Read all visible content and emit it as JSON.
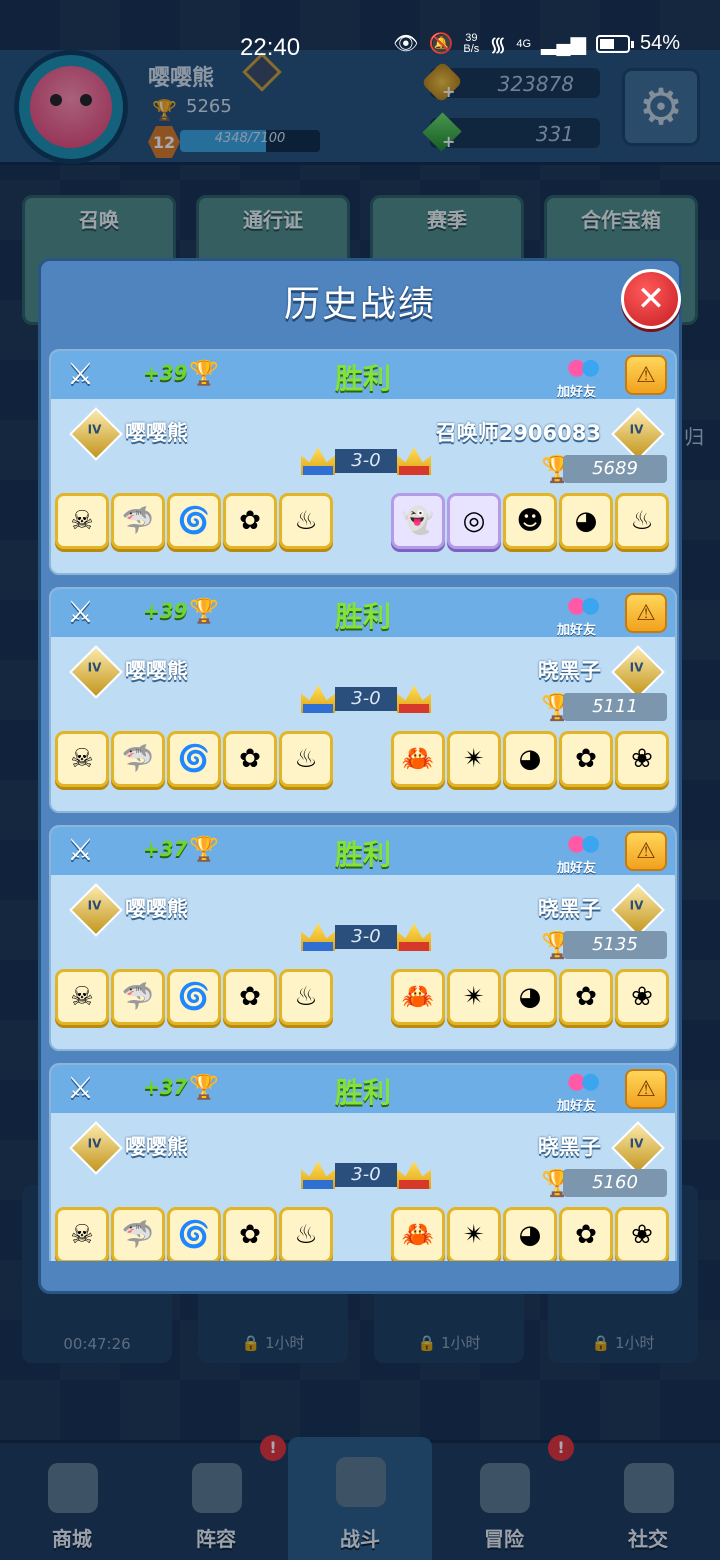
{
  "status_bar": {
    "time": "22:40",
    "net_speed_top": "39",
    "net_speed_bottom": "B/s",
    "network": "4G",
    "battery": "54%"
  },
  "profile": {
    "name": "嘤嘤熊",
    "trophies": "5265",
    "level": "12",
    "xp_text": "4348/7100",
    "xp_fraction": 0.612,
    "gold": "323878",
    "gems": "331"
  },
  "top_tabs": [
    "召唤",
    "通行证",
    "赛季",
    "合作宝箱"
  ],
  "chests": [
    {
      "label": "00:47:26"
    },
    {
      "label": "1小时"
    },
    {
      "label": "1小时"
    },
    {
      "label": "1小时"
    }
  ],
  "side_text": "归",
  "bottom_nav": [
    {
      "label": "商城",
      "icon": "shop-icon"
    },
    {
      "label": "阵容",
      "icon": "dice-icon",
      "alert": "!"
    },
    {
      "label": "战斗",
      "icon": "swords-icon",
      "active": true
    },
    {
      "label": "冒险",
      "icon": "planet-icon",
      "alert": "!"
    },
    {
      "label": "社交",
      "icon": "chat-icon"
    }
  ],
  "modal": {
    "title": "历史战绩",
    "close_label": "✕",
    "add_friend_label": "加好友",
    "records": [
      {
        "trophy_change": "+39",
        "result": "胜利",
        "player_name": "嘤嘤熊",
        "opponent_name": "召唤师2906083",
        "score": "3-0",
        "opponent_trophies": "5689",
        "player_units": [
          "skulls",
          "shark",
          "water",
          "flower",
          "cauldron"
        ],
        "opponent_units": [
          "ghost",
          "vortex",
          "skull-cap",
          "hood",
          "cauldron"
        ]
      },
      {
        "trophy_change": "+39",
        "result": "胜利",
        "player_name": "嘤嘤熊",
        "opponent_name": "晓黑子",
        "score": "3-0",
        "opponent_trophies": "5111",
        "player_units": [
          "skulls",
          "shark",
          "water",
          "flower",
          "cauldron"
        ],
        "opponent_units": [
          "crab",
          "shuriken",
          "hood",
          "flower",
          "sakura"
        ]
      },
      {
        "trophy_change": "+37",
        "result": "胜利",
        "player_name": "嘤嘤熊",
        "opponent_name": "晓黑子",
        "score": "3-0",
        "opponent_trophies": "5135",
        "player_units": [
          "skulls",
          "shark",
          "water",
          "flower",
          "cauldron"
        ],
        "opponent_units": [
          "crab",
          "shuriken",
          "hood",
          "flower",
          "sakura"
        ]
      },
      {
        "trophy_change": "+37",
        "result": "胜利",
        "player_name": "嘤嘤熊",
        "opponent_name": "晓黑子",
        "score": "3-0",
        "opponent_trophies": "5160",
        "player_units": [
          "skulls",
          "shark",
          "water",
          "flower",
          "cauldron"
        ],
        "opponent_units": [
          "crab",
          "shuriken",
          "hood",
          "flower",
          "sakura"
        ]
      }
    ]
  },
  "colors": {
    "win": "#83e33a",
    "panel": "#4f84bf",
    "card": "#bfdcf5",
    "card_header": "#6daee6"
  }
}
